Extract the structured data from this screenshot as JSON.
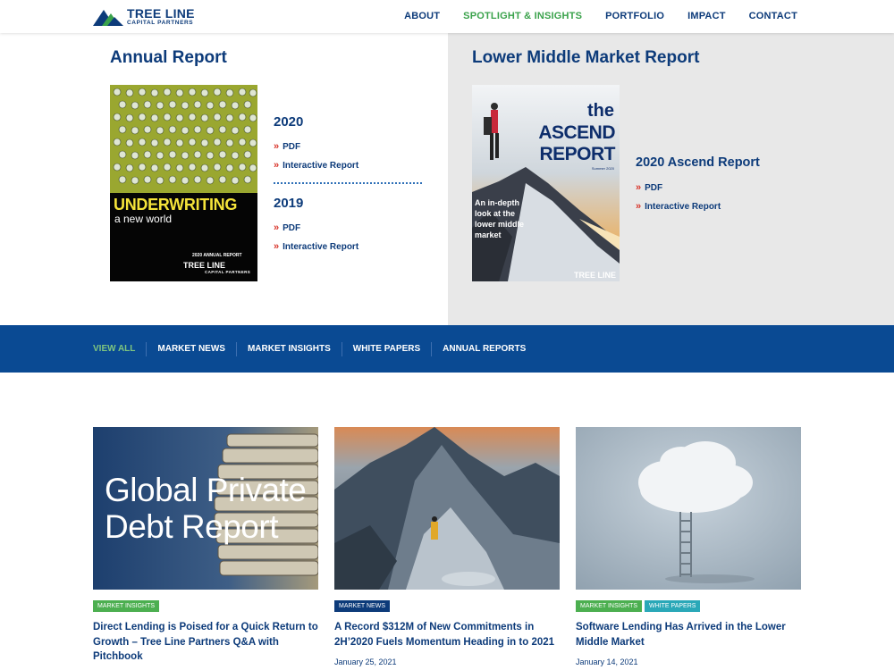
{
  "brand": {
    "name": "TREE LINE",
    "tagline": "CAPITAL PARTNERS"
  },
  "nav": {
    "items": [
      {
        "label": "ABOUT",
        "active": false
      },
      {
        "label": "SPOTLIGHT & INSIGHTS",
        "active": true
      },
      {
        "label": "PORTFOLIO",
        "active": false
      },
      {
        "label": "IMPACT",
        "active": false
      },
      {
        "label": "CONTACT",
        "active": false
      }
    ]
  },
  "annual_report": {
    "title": "Annual Report",
    "cover": {
      "title": "UNDERWRITING",
      "subtitle": "a new world",
      "label": "2020 ANNUAL REPORT",
      "logo": "TREE LINE",
      "logo_sub": "CAPITAL PARTNERS"
    },
    "years": [
      {
        "year": "2020",
        "pdf": "PDF",
        "interactive": "Interactive Report"
      },
      {
        "year": "2019",
        "pdf": "PDF",
        "interactive": "Interactive Report"
      }
    ]
  },
  "lmm_report": {
    "title": "Lower Middle Market Report",
    "cover": {
      "the": "the",
      "title": "ASCEND REPORT",
      "season": "Summer 2020",
      "desc": "An in-depth look at the lower middle market",
      "logo": "TREE LINE"
    },
    "heading": "2020 Ascend Report",
    "pdf": "PDF",
    "interactive": "Interactive Report"
  },
  "filters": [
    "VIEW ALL",
    "MARKET NEWS",
    "MARKET INSIGHTS",
    "WHITE PAPERS",
    "ANNUAL REPORTS"
  ],
  "colors": {
    "brand_blue": "#0d3b7a",
    "filter_bar": "#0a4a93",
    "accent_green": "#3aa24b",
    "chevron_red": "#d8342a",
    "tag_insights": "#4caf50",
    "tag_news": "#0d3b7a",
    "tag_papers": "#2aa8b8"
  },
  "cards": [
    {
      "image_text": "Global Private Debt Report",
      "tags": [
        {
          "label": "MARKET INSIGHTS",
          "color": "#4caf50"
        }
      ],
      "title": "Direct Lending is Poised for a Quick Return to Growth – Tree Line Partners Q&A with Pitchbook",
      "date": ""
    },
    {
      "tags": [
        {
          "label": "MARKET NEWS",
          "color": "#0d3b7a"
        }
      ],
      "title": "A Record $312M of New Commitments in 2H’2020 Fuels Momentum Heading in to 2021",
      "date": "January 25, 2021"
    },
    {
      "tags": [
        {
          "label": "MARKET INSIGHTS",
          "color": "#4caf50"
        },
        {
          "label": "WHITE PAPERS",
          "color": "#2aa8b8"
        }
      ],
      "title": "Software Lending Has Arrived in the Lower Middle Market",
      "date": "January 14, 2021"
    }
  ]
}
